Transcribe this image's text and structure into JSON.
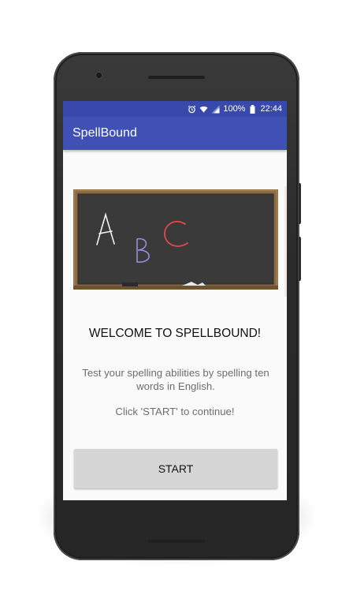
{
  "status_bar": {
    "battery": "100%",
    "time": "22:44",
    "icons": [
      "alarm-icon",
      "wifi-icon",
      "signal-icon",
      "battery-icon"
    ]
  },
  "app_bar": {
    "title": "SpellBound"
  },
  "main": {
    "heading": "WELCOME TO SPELLBOUND!",
    "description": "Test your spelling abilities by spelling ten words in English.",
    "hint": "Click 'START' to continue!",
    "start_button": "START"
  },
  "chalkboard": {
    "letters": [
      "A",
      "B",
      "C"
    ],
    "colors": {
      "A": "#f2f2f2",
      "B": "#9a8ae0",
      "C": "#e0484a"
    }
  },
  "theme": {
    "primary": "#3f51b5",
    "primary_dark": "#3949ab",
    "button": "#d6d6d6"
  }
}
